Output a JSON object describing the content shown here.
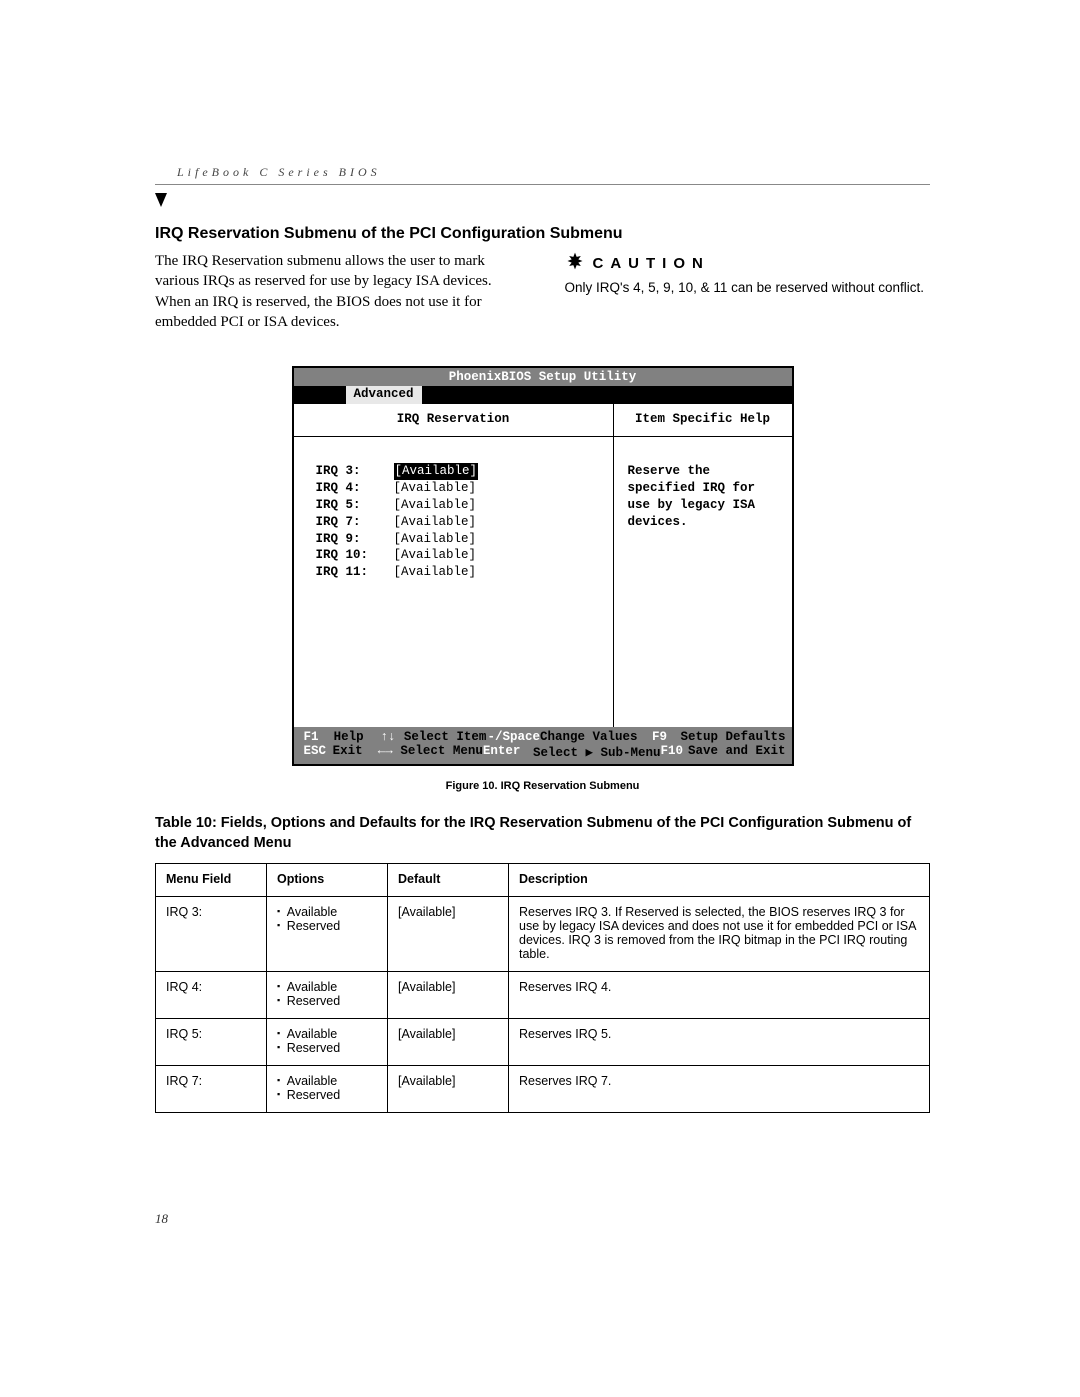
{
  "running_head": "LifeBook C Series BIOS",
  "section_title": "IRQ Reservation Submenu of the PCI Configuration Submenu",
  "intro_paragraph": "The IRQ Reservation submenu allows the user to mark various IRQs as reserved for use by legacy ISA devices. When an IRQ is reserved, the BIOS does not use it for embedded PCI or ISA devices.",
  "caution": {
    "label": "CAUTION",
    "text": "Only IRQ's 4, 5, 9, 10, & 11 can be reserved without conflict."
  },
  "bios": {
    "title": "PhoenixBIOS Setup Utility",
    "active_tab": "Advanced",
    "left_header": "IRQ Reservation",
    "right_header": "Item Specific Help",
    "help_text": "Reserve the specified IRQ for use by legacy ISA devices.",
    "rows": [
      {
        "label": "IRQ 3:",
        "value": "[Available]",
        "selected": true
      },
      {
        "label": "IRQ 4:",
        "value": "[Available]",
        "selected": false
      },
      {
        "label": "IRQ 5:",
        "value": "[Available]",
        "selected": false
      },
      {
        "label": "IRQ 7:",
        "value": "[Available]",
        "selected": false
      },
      {
        "label": "IRQ 9:",
        "value": "[Available]",
        "selected": false
      },
      {
        "label": "IRQ 10:",
        "value": "[Available]",
        "selected": false
      },
      {
        "label": "IRQ 11:",
        "value": "[Available]",
        "selected": false
      }
    ],
    "footer": {
      "r1": {
        "k1": "F1",
        "v1": "Help",
        "k2": "↑↓",
        "v2": "Select Item",
        "k3": "-/Space",
        "v3": "Change Values",
        "k4": "F9",
        "v4": "Setup Defaults"
      },
      "r2": {
        "k1": "ESC",
        "v1": "Exit",
        "k2": "←→",
        "v2": "Select Menu",
        "k3": "Enter",
        "v3": "Select ▶ Sub-Menu",
        "k4": "F10",
        "v4": "Save and Exit"
      }
    }
  },
  "figure_caption": "Figure 10.  IRQ Reservation Submenu",
  "table_title": "Table 10: Fields, Options and Defaults for the IRQ Reservation Submenu of the PCI Configuration Submenu of the Advanced Menu",
  "fields_table": {
    "headers": {
      "menu": "Menu Field",
      "options": "Options",
      "def": "Default",
      "desc": "Description"
    },
    "rows": [
      {
        "menu": "IRQ 3:",
        "options": [
          "Available",
          "Reserved"
        ],
        "def": "[Available]",
        "desc": "Reserves IRQ 3. If Reserved is selected, the BIOS reserves IRQ 3 for use by legacy ISA devices and does not use it for embedded PCI or ISA devices. IRQ 3 is removed from the IRQ bitmap in the PCI IRQ routing table."
      },
      {
        "menu": "IRQ 4:",
        "options": [
          "Available",
          "Reserved"
        ],
        "def": "[Available]",
        "desc": "Reserves IRQ 4."
      },
      {
        "menu": "IRQ 5:",
        "options": [
          "Available",
          "Reserved"
        ],
        "def": "[Available]",
        "desc": "Reserves IRQ 5."
      },
      {
        "menu": "IRQ 7:",
        "options": [
          "Available",
          "Reserved"
        ],
        "def": "[Available]",
        "desc": "Reserves IRQ 7."
      }
    ]
  },
  "page_number": "18"
}
